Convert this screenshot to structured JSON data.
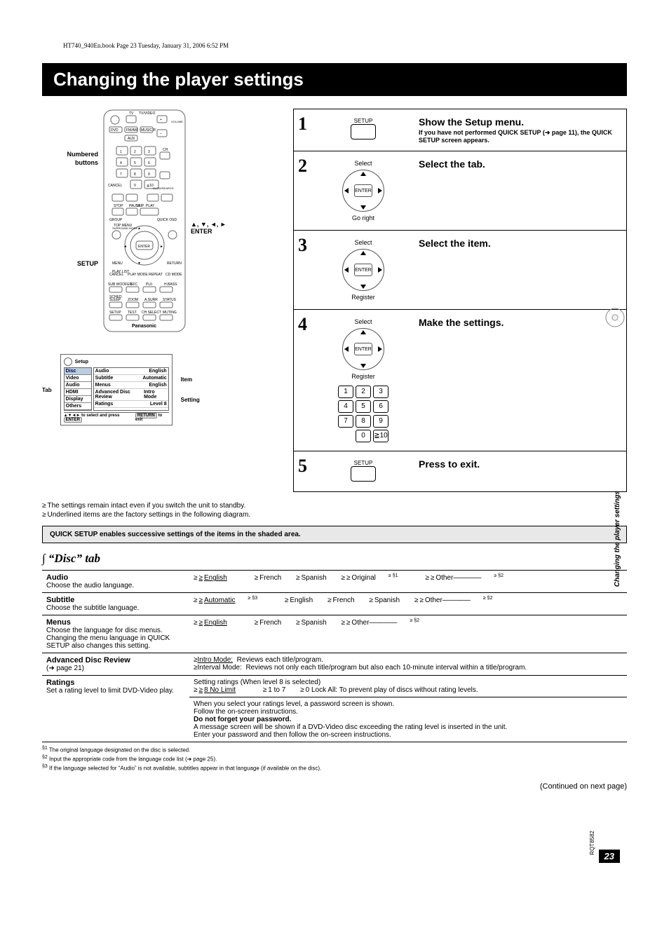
{
  "header_stamp": "HT740_940En.book  Page 23  Tuesday, January 31, 2006  6:52 PM",
  "title": "Changing the player settings",
  "remote": {
    "numbered": "Numbered",
    "buttons": "buttons",
    "directions": "▲, ▼, ◄, ►",
    "enter": "ENTER",
    "setup": "SETUP",
    "brand": "Panasonic",
    "keys": {
      "tv": "TV",
      "tvvideo": "TV/VIDEO",
      "dvd": "DVD",
      "fmam": "FM/AM",
      "music": "MUSIC P.",
      "aux": "AUX",
      "volume": "VOLUME",
      "cancel": "CANCEL",
      "stop": "STOP",
      "pause": "PAUSE",
      "play": "PLAY",
      "group": "GROUP",
      "volplus": "+",
      "volminus": "–",
      "ch": "CH",
      "slow": "SLOW/SEARCH",
      "skip": "SKIP",
      "quick": "QUICK OSD",
      "surround": "SURROUND MODE",
      "menu": "MENU",
      "top": "TOP MENU",
      "return": "RETURN",
      "playmode": "PLAY MODE",
      "repeat": "REPEAT",
      "cdmode": "CD MODE",
      "list": "PLAY LIST",
      "subw": "SUB WOOFER",
      "sfc": "SFC",
      "plii": "PLII",
      "hbass": "H.BASS",
      "sched": "SCHED.",
      "sleep": "SLEEP",
      "zoom": "ZOOM",
      "asurr": "A.SURR",
      "status": "STATUS",
      "setupb": "SETUP",
      "test": "TEST",
      "chsel": "CH SELECT",
      "muting": "MUTING"
    }
  },
  "setup_screen": {
    "label_tab": "Tab",
    "label_item": "Item",
    "label_setting": "Setting",
    "title": "Setup",
    "tabs": [
      "Disc",
      "Video",
      "Audio",
      "HDMI",
      "Display",
      "Others"
    ],
    "rows": [
      {
        "k": "Audio",
        "v": "English"
      },
      {
        "k": "Subtitle",
        "v": "Automatic"
      },
      {
        "k": "Menus",
        "v": "English"
      },
      {
        "k": "Advanced Disc Review",
        "v": "Intro Mode"
      },
      {
        "k": "Ratings",
        "v": "Level 8"
      }
    ],
    "footer_l": "▲▼◄►  to select and press",
    "footer_enter": "ENTER",
    "footer_return": "RETURN",
    "footer_r": "to exit"
  },
  "steps": {
    "s1": {
      "btn": "SETUP",
      "head": "Show the Setup menu.",
      "body": "If you have not performed QUICK SETUP (➜ page 11), the QUICK SETUP screen appears."
    },
    "s2": {
      "sel": "Select",
      "enter": "ENTER",
      "go": "Go right",
      "head": "Select the tab."
    },
    "s3": {
      "sel": "Select",
      "enter": "ENTER",
      "reg": "Register",
      "head": "Select the item."
    },
    "s4": {
      "sel": "Select",
      "enter": "ENTER",
      "reg": "Register",
      "head": "Make the settings.",
      "k1": "1",
      "k2": "2",
      "k3": "3",
      "k4": "4",
      "k5": "5",
      "k6": "6",
      "k7": "7",
      "k8": "8",
      "k9": "9",
      "k0": "0",
      "kge": "≧10"
    },
    "s5": {
      "btn": "SETUP",
      "head": "Press to exit."
    }
  },
  "notes": {
    "n1": "The settings remain intact even if you switch the unit to standby.",
    "n2": "Underlined items are the factory settings in the following diagram."
  },
  "quick_setup": "QUICK SETUP enables successive settings of the items in the shaded area.",
  "disc_tab": {
    "title": "“Disc” tab",
    "audio": {
      "label": "Audio",
      "desc": "Choose the audio language.",
      "o1": "English",
      "o2": "French",
      "o3": "Spanish",
      "o4": "Original",
      "o4sup": "§1",
      "o5": "Other————",
      "o5sup": "§2"
    },
    "subtitle": {
      "label": "Subtitle",
      "desc": "Choose the subtitle language.",
      "o1": "Automatic",
      "o1sup": "§3",
      "o2": "English",
      "o3": "French",
      "o4": "Spanish",
      "o5": "Other————",
      "o5sup": "§2"
    },
    "menus": {
      "label": "Menus",
      "desc": "Choose the language for disc menus. Changing the menu language in QUICK SETUP also changes this setting.",
      "o1": "English",
      "o2": "French",
      "o3": "Spanish",
      "o4": "Other————",
      "o4sup": "§2"
    },
    "adr": {
      "label": "Advanced Disc Review",
      "ref": "(➜ page 21)",
      "o1": "Intro Mode:",
      "o1d": "Reviews each title/program.",
      "o2": "Interval Mode:",
      "o2d": "Reviews not only each title/program but also each 10-minute interval within a title/program."
    },
    "ratings": {
      "label": "Ratings",
      "desc": "Set a rating level to limit DVD-Video play.",
      "lead": "Setting ratings (When level 8 is selected)",
      "o1": "8 No Limit",
      "o2": "1 to 7",
      "o3": "0 Lock All: To prevent play of discs without rating levels.",
      "n1": "When you select your ratings level, a password screen is shown.",
      "n2": "Follow the on-screen instructions.",
      "n3": "Do not forget your password.",
      "n4": "A message screen will be shown if a DVD-Video disc exceeding the rating level is inserted in the unit.",
      "n5": "Enter your password and then follow the on-screen instructions."
    }
  },
  "footnotes": {
    "f1": "The original language designated on the disc is selected.",
    "f2": "Input the appropriate code from the language code list (➜ page 25).",
    "f3": "If the language selected for “Audio” is not available, subtitles appear in that language (if available on the disc).",
    "s1": "§1",
    "s2": "§2",
    "s3": "§3"
  },
  "continued": "(Continued on next page)",
  "side_label": "Changing the player settings",
  "doc_code": "RQT8582",
  "page_num": "23"
}
